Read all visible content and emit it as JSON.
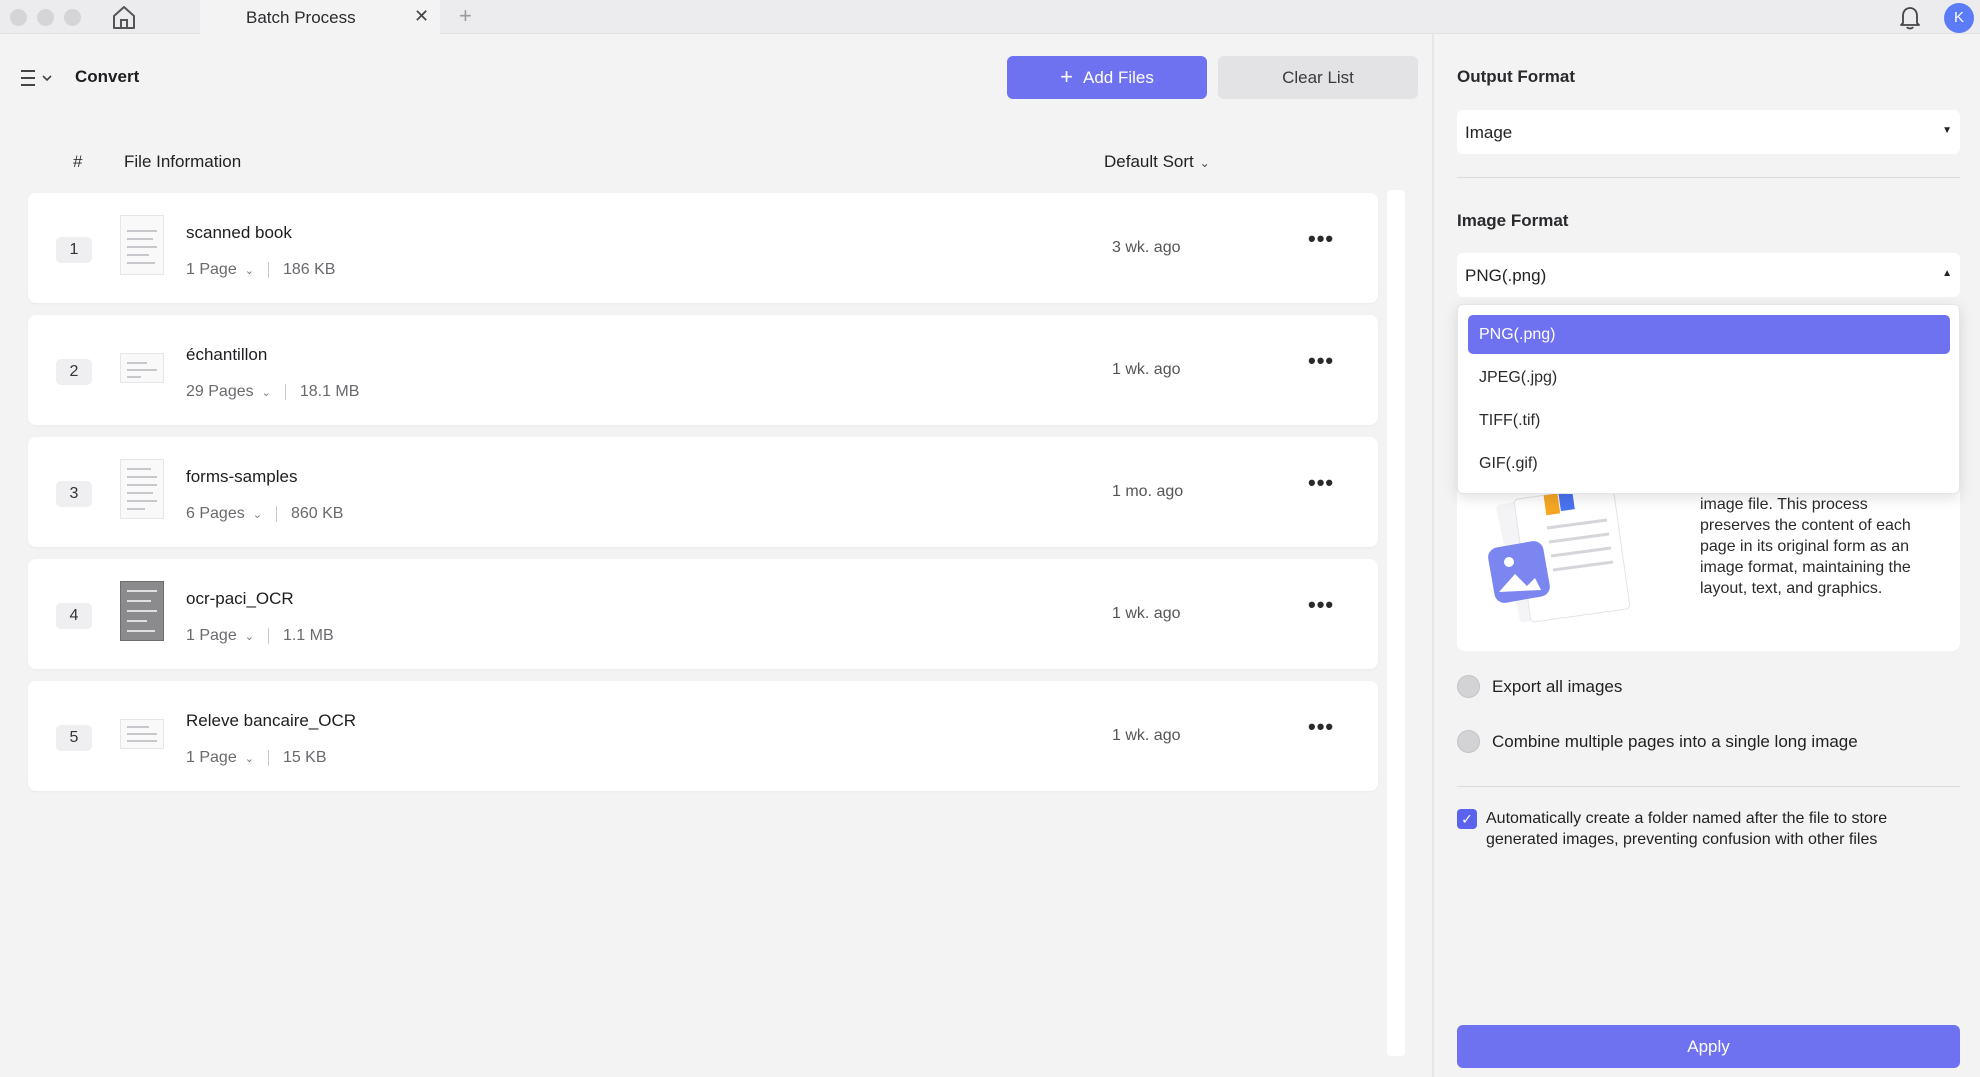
{
  "titlebar": {
    "tab_title": "Batch Process",
    "tab_close": "✕",
    "tab_add": "+",
    "avatar_initial": "K"
  },
  "toolbar": {
    "page_title": "Convert",
    "add_files_label": "Add Files",
    "add_files_icon": "+",
    "clear_list_label": "Clear List"
  },
  "list_header": {
    "index": "#",
    "info": "File Information",
    "sort": "Default Sort"
  },
  "files": [
    {
      "num": "1",
      "name": "scanned book",
      "pages": "1 Page",
      "size": "186 KB",
      "date": "3 wk. ago"
    },
    {
      "num": "2",
      "name": "échantillon",
      "pages": "29 Pages",
      "size": "18.1 MB",
      "date": "1 wk. ago"
    },
    {
      "num": "3",
      "name": "forms-samples",
      "pages": "6 Pages",
      "size": "860 KB",
      "date": "1 mo. ago"
    },
    {
      "num": "4",
      "name": "ocr-paci_OCR",
      "pages": "1 Page",
      "size": "1.1 MB",
      "date": "1 wk. ago"
    },
    {
      "num": "5",
      "name": "Releve bancaire_OCR",
      "pages": "1 Page",
      "size": "15 KB",
      "date": "1 wk. ago"
    }
  ],
  "panel": {
    "output_format_label": "Output Format",
    "output_format_value": "Image",
    "image_format_label": "Image Format",
    "image_format_value": "PNG(.png)",
    "image_format_options": [
      "PNG(.png)",
      "JPEG(.jpg)",
      "TIFF(.tif)",
      "GIF(.gif)"
    ],
    "description": "image file. This process preserves the content of each page in its original form as an image format, maintaining the layout, text, and graphics.",
    "export_all_images": "Export all images",
    "combine_pages": "Combine multiple pages into a single long image",
    "auto_folder": "Automatically create a folder named after the file to store generated images, preventing confusion with other files",
    "apply_label": "Apply"
  },
  "colors": {
    "accent": "#6e72f0",
    "avatar": "#5b7cf6"
  }
}
